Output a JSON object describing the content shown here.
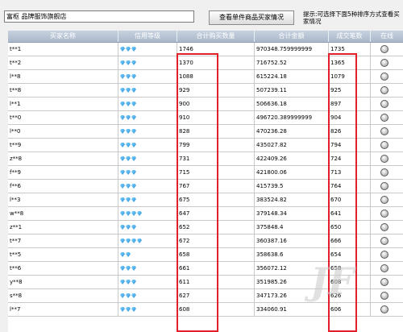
{
  "toolbar": {
    "shop_name": "富枢      品牌服饰旗舰店",
    "view_button_label": "查看单件商品买家情况",
    "hint": "提示:可选择下面5种排序方式查看买家情况"
  },
  "table": {
    "columns": [
      "买家名称",
      "信用等级",
      "合计购买数量",
      "合计金额",
      "成交笔数",
      "在线"
    ],
    "rows": [
      {
        "name": "t**1",
        "level": 3,
        "qty": "1746",
        "amount": "970348.759999999",
        "deals": "1735"
      },
      {
        "name": "t**2",
        "level": 3,
        "qty": "1370",
        "amount": "716752.52",
        "deals": "1365"
      },
      {
        "name": "l**8",
        "level": 3,
        "qty": "1088",
        "amount": "615224.18",
        "deals": "1079"
      },
      {
        "name": "t**8",
        "level": 3,
        "qty": "929",
        "amount": "507239.11",
        "deals": "925"
      },
      {
        "name": "l**1",
        "level": 3,
        "qty": "900",
        "amount": "506636.18",
        "deals": "897"
      },
      {
        "name": "t**0",
        "level": 3,
        "qty": "910",
        "amount": "496720.389999999",
        "deals": "904"
      },
      {
        "name": "l**0",
        "level": 3,
        "qty": "828",
        "amount": "470236.28",
        "deals": "826"
      },
      {
        "name": "t**9",
        "level": 3,
        "qty": "799",
        "amount": "435027.82",
        "deals": "794"
      },
      {
        "name": "z**8",
        "level": 3,
        "qty": "731",
        "amount": "422409.26",
        "deals": "724"
      },
      {
        "name": "f**9",
        "level": 3,
        "qty": "715",
        "amount": "421800.06",
        "deals": "713"
      },
      {
        "name": "f**6",
        "level": 3,
        "qty": "767",
        "amount": "415739.5",
        "deals": "764"
      },
      {
        "name": "l**3",
        "level": 3,
        "qty": "675",
        "amount": "383524.82",
        "deals": "670"
      },
      {
        "name": "w**8",
        "level": 4,
        "qty": "647",
        "amount": "379148.34",
        "deals": "641"
      },
      {
        "name": "z**1",
        "level": 3,
        "qty": "652",
        "amount": "375848.4",
        "deals": "650"
      },
      {
        "name": "t**7",
        "level": 4,
        "qty": "672",
        "amount": "360387.16",
        "deals": "666"
      },
      {
        "name": "t**5",
        "level": 2,
        "qty": "658",
        "amount": "358638.6",
        "deals": "654"
      },
      {
        "name": "t**6",
        "level": 3,
        "qty": "661",
        "amount": "356072.12",
        "deals": "658"
      },
      {
        "name": "y**8",
        "level": 3,
        "qty": "611",
        "amount": "351985.26",
        "deals": "608"
      },
      {
        "name": "s**8",
        "level": 3,
        "qty": "627",
        "amount": "347173.26",
        "deals": "626"
      },
      {
        "name": "l**7",
        "level": 3,
        "qty": "608",
        "amount": "334060.91",
        "deals": "606"
      }
    ]
  },
  "watermark": "JF",
  "colors": {
    "highlight": "#e3202a",
    "header": "#aab8cb"
  }
}
